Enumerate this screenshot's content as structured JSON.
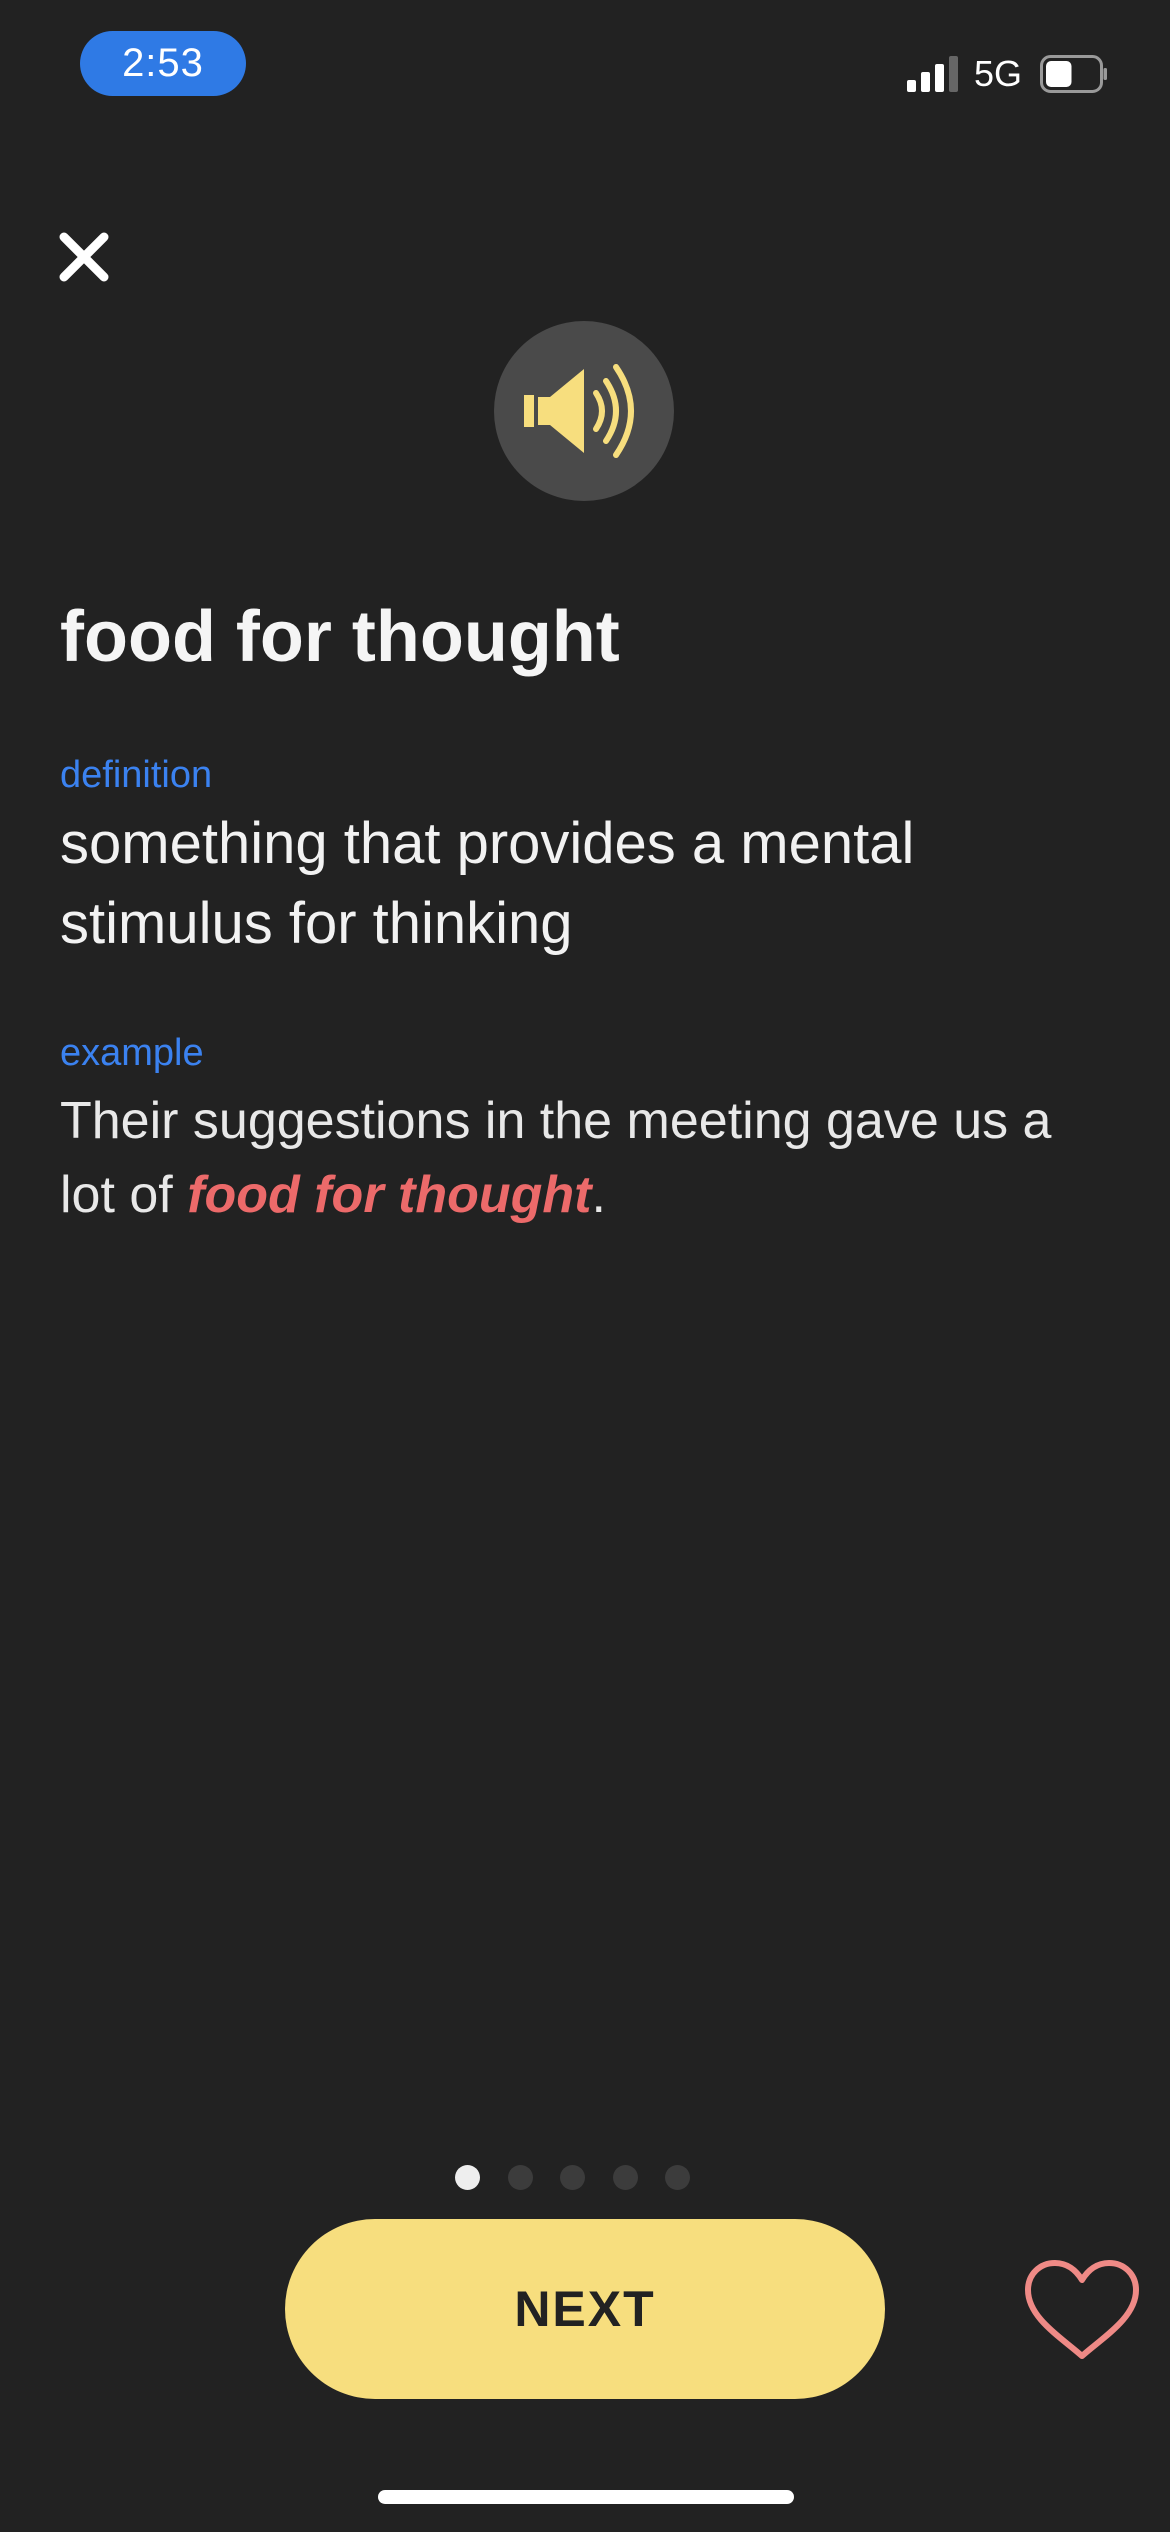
{
  "status_bar": {
    "time": "2:53",
    "network": "5G",
    "signal_bars_filled": 3,
    "signal_bars_total": 4,
    "battery_level": 0.5
  },
  "icons": {
    "close": "close-icon",
    "audio": "speaker-icon",
    "favorite": "heart-icon"
  },
  "card": {
    "phrase": "food for thought",
    "definition_label": "definition",
    "definition_text": "something that provides a mental stimulus for thinking",
    "example_label": "example",
    "example_before": "Their suggestions in the meeting gave us a lot of ",
    "example_highlight": "food for thought",
    "example_after": "."
  },
  "pager": {
    "total": 5,
    "current": 1
  },
  "actions": {
    "next_label": "NEXT"
  },
  "colors": {
    "background": "#222222",
    "accent_blue": "#3b82f0",
    "highlight_red": "#ec6a6a",
    "button_yellow": "#f7de7e",
    "heart_pink": "#ef8a86",
    "speaker_yellow": "#f7de7e"
  }
}
